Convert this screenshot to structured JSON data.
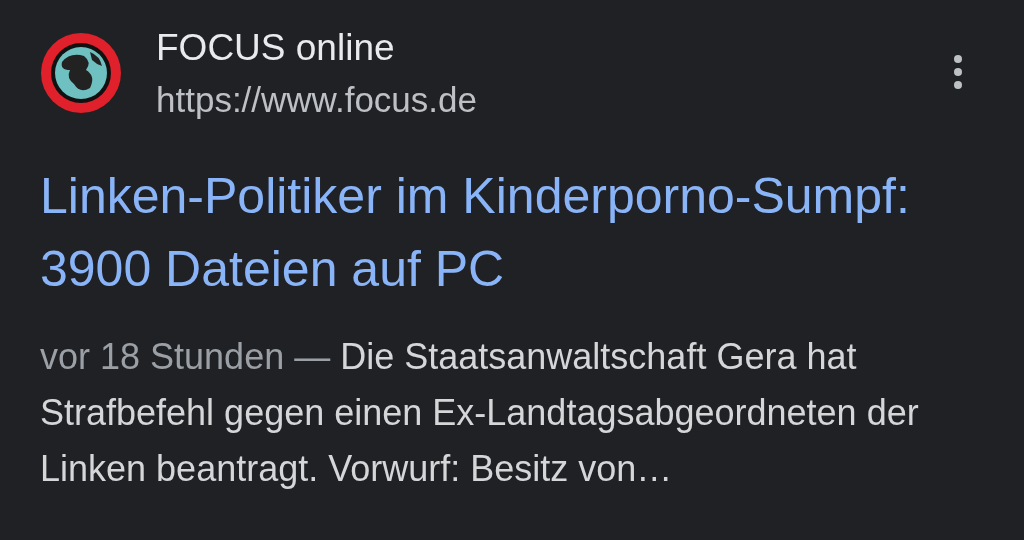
{
  "source": {
    "name": "FOCUS online",
    "url": "https://www.focus.de"
  },
  "headline": "Linken-Politiker im Kinderporno-Sumpf: 3900 Dateien auf PC",
  "snippet": {
    "date": "vor 18 Stunden —",
    "text": "Die Staatsanwaltschaft Gera hat Strafbefehl gegen einen Ex-Landtagsabgeordneten der Linken beantragt. Vorwurf: Besitz von…"
  }
}
